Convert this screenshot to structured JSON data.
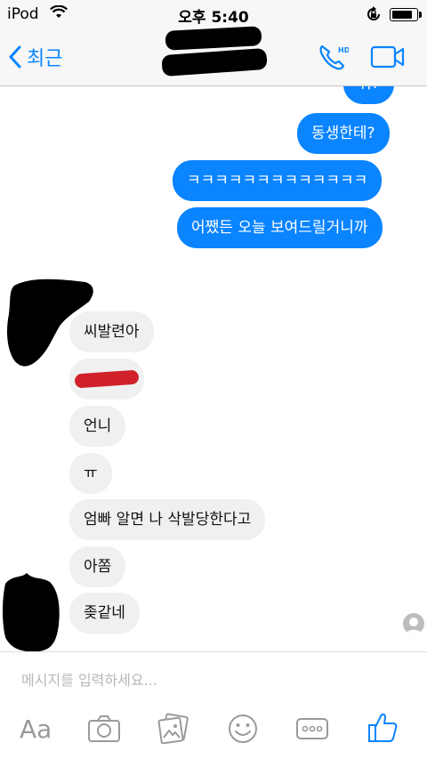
{
  "status_bar": {
    "carrier": "iPod",
    "time": "오후 5:40",
    "battery_level": 0.85
  },
  "nav": {
    "back_label": "최근",
    "call_badge": "HD"
  },
  "messages": [
    {
      "side": "out",
      "text": "뭐?"
    },
    {
      "side": "out",
      "text": "동생한테?"
    },
    {
      "side": "out",
      "text": "ㅋㅋㅋㅋㅋㅋㅋㅋㅋㅋㅋㅋㅋ"
    },
    {
      "side": "out",
      "text": "어쨌든 오늘 보여드릴거니까"
    },
    {
      "side": "in",
      "text": "씨발련아"
    },
    {
      "side": "in",
      "text": ""
    },
    {
      "side": "in",
      "text": "언니"
    },
    {
      "side": "in",
      "text": "ㅠ"
    },
    {
      "side": "in",
      "text": "엄빠 알면 나 삭발당한다고"
    },
    {
      "side": "in",
      "text": "아쫌"
    },
    {
      "side": "in",
      "text": "좆같네"
    }
  ],
  "composer": {
    "placeholder": "메시지를 입력하세요...",
    "text_icon_label": "Aa"
  },
  "colors": {
    "accent": "#0a84ff",
    "incoming_bubble": "#f0f0f0",
    "redaction": "#000000",
    "redaction_red": "#d0202a"
  }
}
